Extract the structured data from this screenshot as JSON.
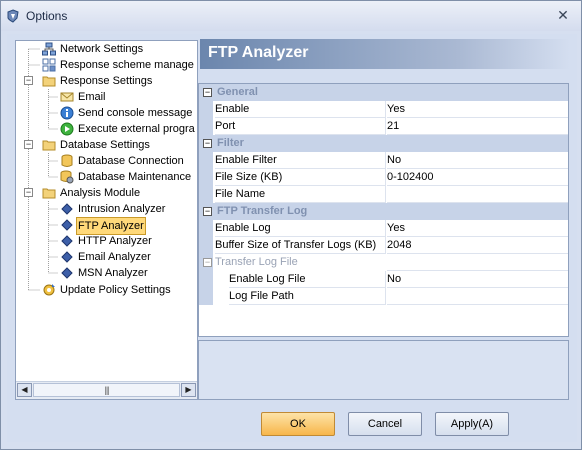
{
  "window": {
    "title": "Options",
    "close_glyph": "✕",
    "icon": "shield-icon"
  },
  "tree": {
    "items": [
      {
        "label": "Network Settings",
        "icon": "network-icon",
        "level": 1
      },
      {
        "label": "Response scheme manage",
        "icon": "scheme-icon",
        "level": 1
      },
      {
        "label": "Response Settings",
        "icon": "folder-icon",
        "level": 0,
        "expander": "−"
      },
      {
        "label": "Email",
        "icon": "envelope-icon",
        "level": 2
      },
      {
        "label": "Send console message",
        "icon": "info-icon",
        "level": 2
      },
      {
        "label": "Execute external progra",
        "icon": "play-icon",
        "level": 2
      },
      {
        "label": "Database Settings",
        "icon": "folder-icon",
        "level": 0,
        "expander": "−"
      },
      {
        "label": "Database Connection",
        "icon": "database-icon",
        "level": 2
      },
      {
        "label": "Database Maintenance",
        "icon": "database-maint-icon",
        "level": 2
      },
      {
        "label": "Analysis Module",
        "icon": "folder-icon",
        "level": 0,
        "expander": "−"
      },
      {
        "label": "Intrusion Analyzer",
        "icon": "diamond-icon",
        "level": 2
      },
      {
        "label": "FTP Analyzer",
        "icon": "diamond-icon",
        "level": 2,
        "selected": true
      },
      {
        "label": "HTTP Analyzer",
        "icon": "diamond-icon",
        "level": 2
      },
      {
        "label": "Email Analyzer",
        "icon": "diamond-icon",
        "level": 2
      },
      {
        "label": "MSN Analyzer",
        "icon": "diamond-icon",
        "level": 2
      },
      {
        "label": "Update Policy Settings",
        "icon": "update-icon",
        "level": 1
      }
    ],
    "scroll_left": "◀",
    "scroll_right": "▶",
    "scroll_grip": "|||"
  },
  "header": {
    "title": "FTP Analyzer"
  },
  "grid": {
    "general": {
      "label": "General",
      "toggle": "−",
      "enable_name": "Enable",
      "enable_value": "Yes",
      "port_name": "Port",
      "port_value": "21"
    },
    "filter": {
      "label": "Filter",
      "toggle": "−",
      "enable_filter_name": "Enable Filter",
      "enable_filter_value": "No",
      "file_size_name": "File Size (KB)",
      "file_size_value": "0-102400",
      "file_name_name": "File Name",
      "file_name_value": ""
    },
    "transfer_log": {
      "label": "FTP Transfer Log",
      "toggle": "−",
      "enable_log_name": "Enable Log",
      "enable_log_value": "Yes",
      "buffer_name": "Buffer Size of Transfer Logs (KB)",
      "buffer_value": "2048",
      "subcat_label": "Transfer Log File",
      "subcat_toggle": "−",
      "enable_log_file_name": "Enable Log File",
      "enable_log_file_value": "No",
      "log_path_name": "Log File Path",
      "log_path_value": ""
    }
  },
  "buttons": {
    "ok": "OK",
    "cancel": "Cancel",
    "apply": "Apply(A)"
  },
  "colors": {
    "selection": "#ffd97a",
    "ok_button": "#f7b64b",
    "header_band": "#6b86ad"
  }
}
